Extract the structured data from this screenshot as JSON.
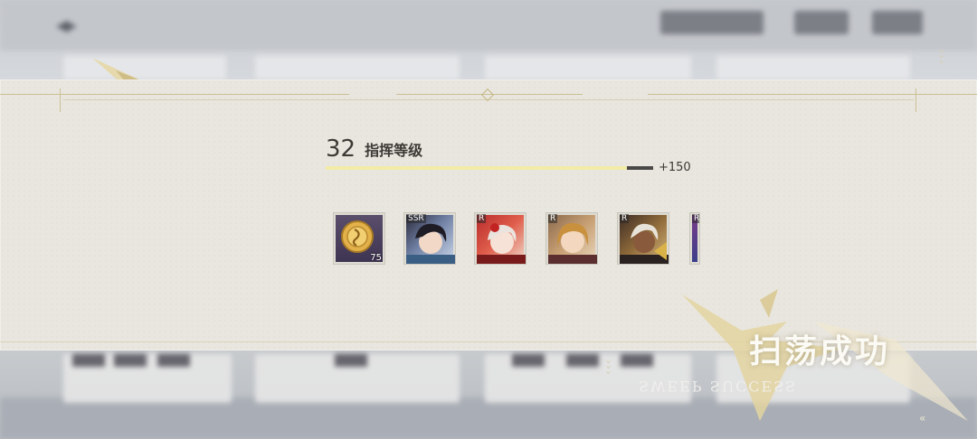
{
  "result": {
    "level": "32",
    "level_label": "指挥等级",
    "exp_gain": "+150",
    "exp_progress": 0.92,
    "title": "扫荡成功",
    "title_en": "SWEEP SUCCESS"
  },
  "rewards": [
    {
      "name": "gold-coin",
      "qty": "75",
      "rank": ""
    },
    {
      "name": "character-card-ssr",
      "qty": "",
      "rank": "SSR"
    },
    {
      "name": "character-card-r-red",
      "qty": "",
      "rank": "R"
    },
    {
      "name": "character-card-r-blonde",
      "qty": "",
      "rank": "R"
    },
    {
      "name": "character-card-r-dark",
      "qty": "",
      "rank": "R"
    },
    {
      "name": "character-card-r-partial",
      "qty": "",
      "rank": "R"
    }
  ],
  "colors": {
    "banner": "#e9e6df",
    "exp_fill": "#f1eca6",
    "text": "#3d3a36",
    "accent_gold": "#cbbf95"
  }
}
